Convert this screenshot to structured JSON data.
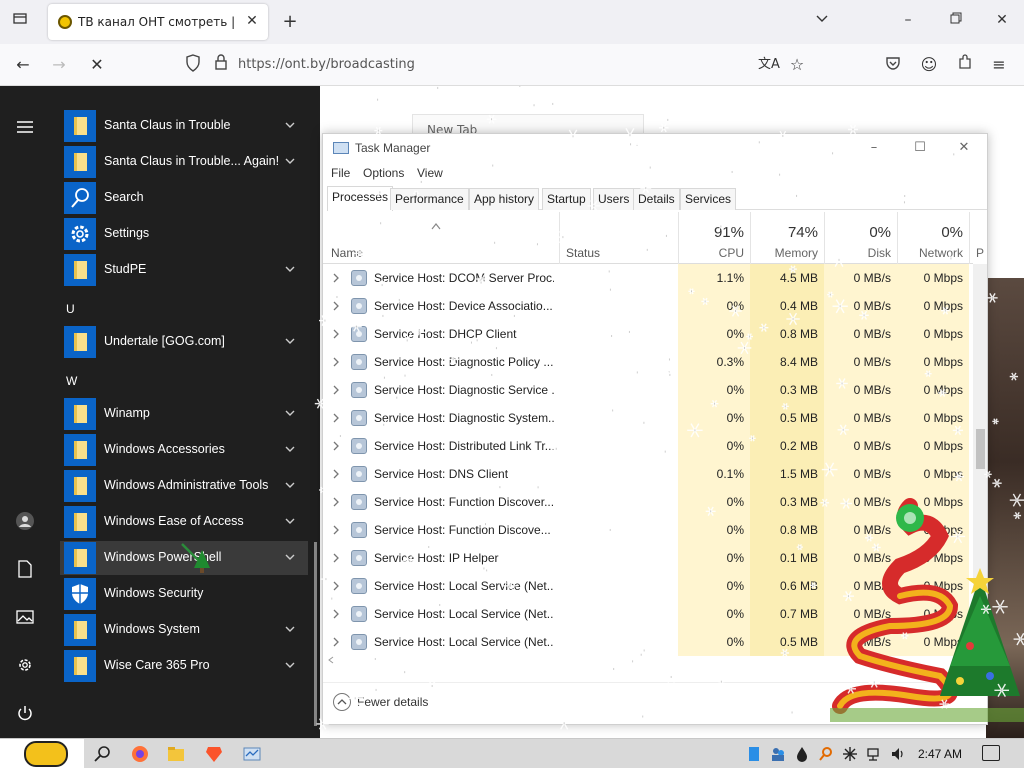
{
  "browser": {
    "tab_title": "ТВ канал ОНТ смотреть | онл",
    "url": "https://ont.by/broadcasting",
    "new_tab_ghost": "New Tab"
  },
  "start_menu": {
    "items": [
      {
        "label": "Santa Claus in Trouble",
        "type": "folder",
        "chevron": true
      },
      {
        "label": "Santa Claus in Trouble... Again!",
        "type": "folder",
        "chevron": true
      },
      {
        "label": "Search",
        "type": "search",
        "chevron": false
      },
      {
        "label": "Settings",
        "type": "settings",
        "chevron": false
      },
      {
        "label": "StudPE",
        "type": "folder",
        "chevron": true
      },
      {
        "header": "U"
      },
      {
        "label": "Undertale [GOG.com]",
        "type": "folder",
        "chevron": true
      },
      {
        "header": "W"
      },
      {
        "label": "Winamp",
        "type": "folder",
        "chevron": true
      },
      {
        "label": "Windows Accessories",
        "type": "folder",
        "chevron": true
      },
      {
        "label": "Windows Administrative Tools",
        "type": "folder",
        "chevron": true
      },
      {
        "label": "Windows Ease of Access",
        "type": "folder",
        "chevron": true
      },
      {
        "label": "Windows PowerShell",
        "type": "folder",
        "chevron": true,
        "highlight": true
      },
      {
        "label": "Windows Security",
        "type": "shield",
        "chevron": false
      },
      {
        "label": "Windows System",
        "type": "folder",
        "chevron": true
      },
      {
        "label": "Wise Care 365 Pro",
        "type": "folder",
        "chevron": true
      }
    ]
  },
  "task_manager": {
    "title": "Task Manager",
    "menu": [
      "File",
      "Options",
      "View"
    ],
    "tabs": [
      "Processes",
      "Performance",
      "App history",
      "Startup",
      "Users",
      "Details",
      "Services"
    ],
    "active_tab": "Processes",
    "columns": {
      "name": "Name",
      "status": "Status",
      "cpu": {
        "pct": "91%",
        "label": "CPU"
      },
      "memory": {
        "pct": "74%",
        "label": "Memory"
      },
      "disk": {
        "pct": "0%",
        "label": "Disk"
      },
      "network": {
        "pct": "0%",
        "label": "Network"
      },
      "power": "P"
    },
    "rows": [
      {
        "name": "Service Host: DCOM Server Proc...",
        "cpu": "1.1%",
        "mem": "4.5 MB",
        "disk": "0 MB/s",
        "net": "0 Mbps"
      },
      {
        "name": "Service Host: Device Associatio...",
        "cpu": "0%",
        "mem": "0.4 MB",
        "disk": "0 MB/s",
        "net": "0 Mbps"
      },
      {
        "name": "Service Host: DHCP Client",
        "cpu": "0%",
        "mem": "0.8 MB",
        "disk": "0 MB/s",
        "net": "0 Mbps"
      },
      {
        "name": "Service Host: Diagnostic Policy ...",
        "cpu": "0.3%",
        "mem": "8.4 MB",
        "disk": "0 MB/s",
        "net": "0 Mbps"
      },
      {
        "name": "Service Host: Diagnostic Service ...",
        "cpu": "0%",
        "mem": "0.3 MB",
        "disk": "0 MB/s",
        "net": "0 Mbps"
      },
      {
        "name": "Service Host: Diagnostic System...",
        "cpu": "0%",
        "mem": "0.5 MB",
        "disk": "0 MB/s",
        "net": "0 Mbps"
      },
      {
        "name": "Service Host: Distributed Link Tr...",
        "cpu": "0%",
        "mem": "0.2 MB",
        "disk": "0 MB/s",
        "net": "0 Mbps"
      },
      {
        "name": "Service Host: DNS Client",
        "cpu": "0.1%",
        "mem": "1.5 MB",
        "disk": "0 MB/s",
        "net": "0 Mbps"
      },
      {
        "name": "Service Host: Function Discover...",
        "cpu": "0%",
        "mem": "0.3 MB",
        "disk": "0 MB/s",
        "net": "0 Mbps"
      },
      {
        "name": "Service Host: Function Discove...",
        "cpu": "0%",
        "mem": "0.8 MB",
        "disk": "0 MB/s",
        "net": "0 Mbps"
      },
      {
        "name": "Service Host: IP Helper",
        "cpu": "0%",
        "mem": "0.1 MB",
        "disk": "0 MB/s",
        "net": "0 Mbps"
      },
      {
        "name": "Service Host: Local Service (Net...",
        "cpu": "0%",
        "mem": "0.6 MB",
        "disk": "0 MB/s",
        "net": "0 Mbps"
      },
      {
        "name": "Service Host: Local Service (Net...",
        "cpu": "0%",
        "mem": "0.7 MB",
        "disk": "0 MB/s",
        "net": "0 Mbps"
      },
      {
        "name": "Service Host: Local Service (Net...",
        "cpu": "0%",
        "mem": "0.5 MB",
        "disk": "0 MB/s",
        "net": "0 Mbps"
      }
    ],
    "footer": "Fewer details"
  },
  "taskbar": {
    "clock": "2:47 AM"
  },
  "colors": {
    "start_bg": "#1f1f1f",
    "tile_blue": "#0a64c8",
    "cpu_heat": "#fff5d0",
    "mem_heat": "#fbeeb5"
  }
}
